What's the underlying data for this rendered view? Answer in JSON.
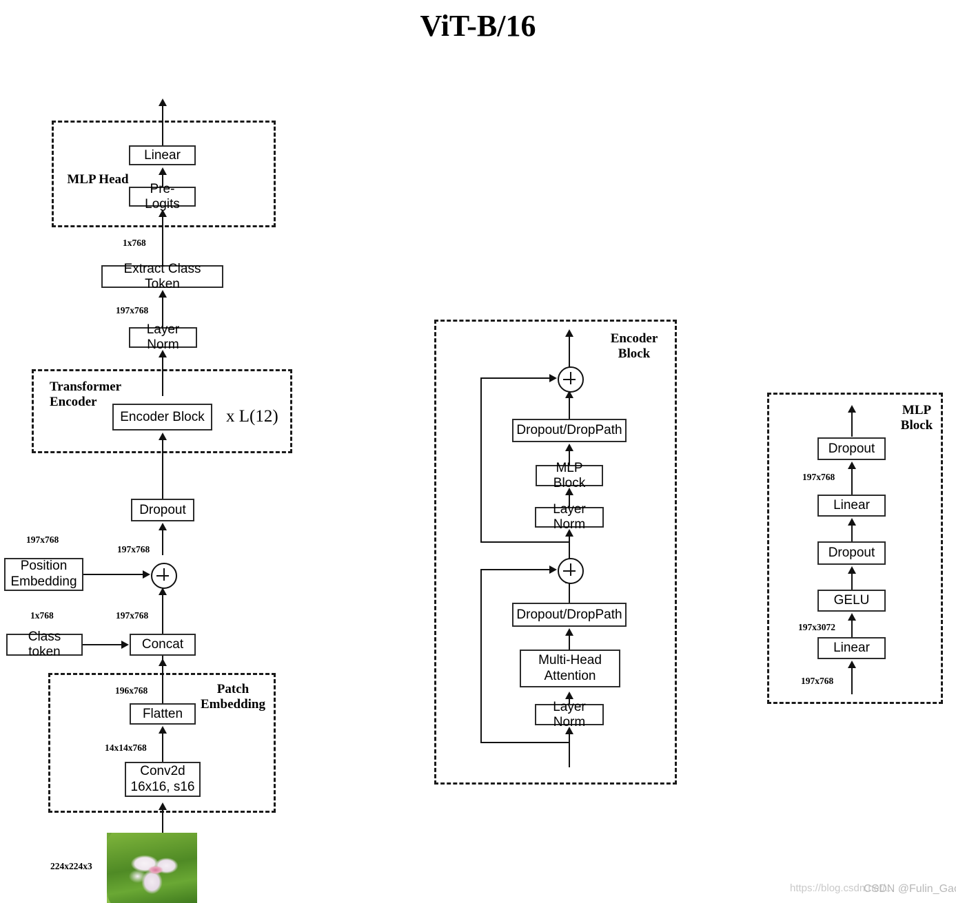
{
  "title": "ViT-B/16",
  "left_column": {
    "group_mlp_head": {
      "label": "MLP Head"
    },
    "group_transformer_encoder": {
      "label": "Transformer\nEncoder"
    },
    "group_patch_embedding": {
      "label": "Patch\nEmbedding"
    },
    "nodes": {
      "linear": "Linear",
      "pre_logits": "Pre-Logits",
      "extract_class_token": "Extract Class Token",
      "layer_norm": "Layer Norm",
      "encoder_block": "Encoder Block",
      "dropout": "Dropout",
      "position_embedding": "Position\nEmbedding",
      "class_token": "Class token",
      "concat": "Concat",
      "flatten": "Flatten",
      "conv2d": "Conv2d\n16x16, s16"
    },
    "multiplier": "x L(12)",
    "dims": {
      "to_mlp_head": "1x768",
      "to_layer_norm_out": "197x768",
      "pos_embed_out": "197x768",
      "add_out": "197x768",
      "class_token_out": "1x768",
      "concat_out": "197x768",
      "flatten_out": "196x768",
      "conv_out": "14x14x768",
      "input_image": "224x224x3"
    },
    "image_alt": "flower-photo"
  },
  "encoder_block": {
    "group_label": "Encoder\nBlock",
    "nodes": {
      "dropout_droppath_mlp": "Dropout/DropPath",
      "mlp_block": "MLP Block",
      "layer_norm_2": "Layer Norm",
      "dropout_droppath_attn": "Dropout/DropPath",
      "multi_head_attention": "Multi-Head\nAttention",
      "layer_norm_1": "Layer Norm"
    },
    "add_symbol": "+"
  },
  "mlp_block": {
    "group_label": "MLP\nBlock",
    "nodes": {
      "dropout_2": "Dropout",
      "linear_2": "Linear",
      "dropout_1": "Dropout",
      "gelu": "GELU",
      "linear_1": "Linear"
    },
    "dims": {
      "linear2_out": "197x768",
      "linear1_out": "197x3072",
      "input": "197x768"
    }
  },
  "watermark": {
    "url": "https://blog.csdn.net/...",
    "user": "CSDN @Fulin_Gao"
  },
  "colors": {
    "stroke": "#2b2b2b",
    "line": "#111111",
    "background": "#ffffff",
    "watermark": "#c9c9c9"
  }
}
